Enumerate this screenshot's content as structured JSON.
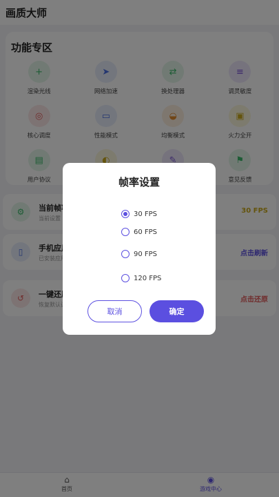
{
  "app": {
    "title": "画质大师"
  },
  "feature_card": {
    "title": "功能专区",
    "items": [
      {
        "label": "渲染光线",
        "icon": "plus-icon",
        "glyph": "+",
        "bg": "#e3f5e8",
        "fg": "#3bb86a"
      },
      {
        "label": "网络加速",
        "icon": "rocket-icon",
        "glyph": "➤",
        "bg": "#e6ecfb",
        "fg": "#4a6fe0"
      },
      {
        "label": "换处理器",
        "icon": "swap-icon",
        "glyph": "⇄",
        "bg": "#e3f5e8",
        "fg": "#3bb86a"
      },
      {
        "label": "调灵敏度",
        "icon": "menu-icon",
        "glyph": "≡",
        "bg": "#ede6fb",
        "fg": "#7a55d6"
      },
      {
        "label": "核心调度",
        "icon": "target-icon",
        "glyph": "◎",
        "bg": "#fbe6e6",
        "fg": "#e05a5a"
      },
      {
        "label": "性能模式",
        "icon": "battery-icon",
        "glyph": "▭",
        "bg": "#e6ecfb",
        "fg": "#4a6fe0"
      },
      {
        "label": "均衡模式",
        "icon": "gauge-icon",
        "glyph": "◒",
        "bg": "#fdeede",
        "fg": "#e08a2c"
      },
      {
        "label": "火力全开",
        "icon": "lock-icon",
        "glyph": "▣",
        "bg": "#fbf6dc",
        "fg": "#c9a81a"
      },
      {
        "label": "用户协议",
        "icon": "document-icon",
        "glyph": "▤",
        "bg": "#e3f5e8",
        "fg": "#3bb86a"
      },
      {
        "label": "",
        "icon": "shield-icon",
        "glyph": "◐",
        "bg": "#fbf6dc",
        "fg": "#c9a81a"
      },
      {
        "label": "",
        "icon": "wrench-icon",
        "glyph": "✎",
        "bg": "#ede6fb",
        "fg": "#7a55d6"
      },
      {
        "label": "意见反馈",
        "icon": "flag-icon",
        "glyph": "⚑",
        "bg": "#e3f5e8",
        "fg": "#3bb86a"
      }
    ]
  },
  "info_cards": [
    {
      "title": "当前帧率",
      "subtitle": "当前设置",
      "action": "30 FPS",
      "icon": "settings-icon",
      "glyph": "⚙",
      "bg": "#e3f5e8",
      "fg": "#3bb86a",
      "action_color": "#c9a81a"
    },
    {
      "title": "手机应用",
      "subtitle": "已安装应用",
      "action": "点击刷新",
      "icon": "phone-icon",
      "glyph": "▯",
      "bg": "#e6ecfb",
      "fg": "#4a6fe0",
      "action_color": "#5b4fe0"
    },
    {
      "title": "一键还原",
      "subtitle": "恢复默认设置",
      "action": "点击还原",
      "icon": "restore-icon",
      "glyph": "↺",
      "bg": "#fbe6e6",
      "fg": "#e05a5a",
      "action_color": "#e05a5a"
    }
  ],
  "bottom_nav": {
    "items": [
      {
        "label": "首页",
        "icon": "home-icon",
        "glyph": "⌂",
        "active": false
      },
      {
        "label": "游戏中心",
        "icon": "gamepad-icon",
        "glyph": "◉",
        "active": true
      }
    ]
  },
  "dialog": {
    "title": "帧率设置",
    "options": [
      "30 FPS",
      "60 FPS",
      "90 FPS",
      "120 FPS"
    ],
    "selected": "30 FPS",
    "cancel_label": "取消",
    "confirm_label": "确定"
  },
  "colors": {
    "accent": "#5b4fe0"
  }
}
